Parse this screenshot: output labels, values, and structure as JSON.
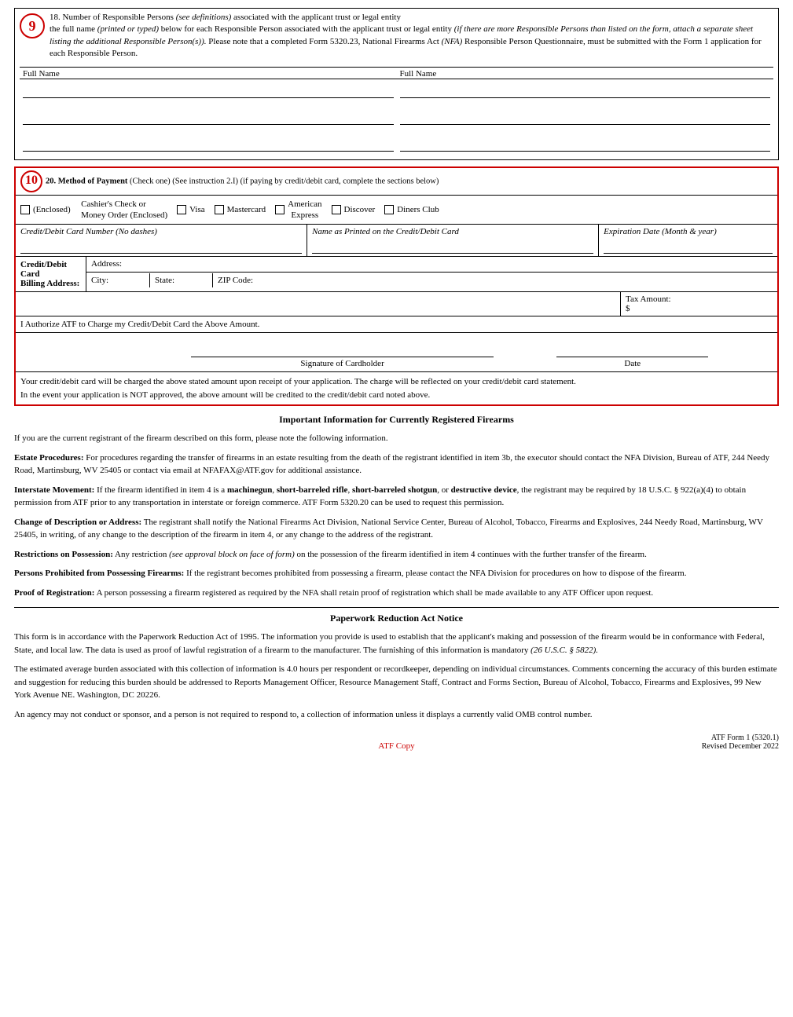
{
  "section18": {
    "number": "9",
    "header_prefix": "18. Number of Responsible Persons ",
    "header_italic": "(see definitions)",
    "header_suffix": " associated with the applicant trust or legal entity",
    "body": "the full name ",
    "body_italic1": "(printed or typed)",
    "body2": " below for each Responsible Person associated with the applicant trust or legal entity ",
    "body_italic2": "(if there are more Responsible Persons than listed on the form, attach a separate sheet listing the additional Responsible Person(s)).",
    "body3": " Please note that a completed Form 5320.23, National Firearms Act ",
    "body_italic3": "(NFA)",
    "body4": " Responsible Person Questionnaire, must be submitted with the Form 1 application for each Responsible Person.",
    "col1_label": "Full Name",
    "col2_label": "Full Name"
  },
  "section20": {
    "number": "10",
    "header": "20. Method of Payment ",
    "header_italic": "(Check one) (See instruction 2.I) (if paying by credit/debit card, complete the sections below)",
    "options": [
      {
        "label": "Money Order (Enclosed)",
        "sub": "Cashier's Check or\nMoney Order (Enclosed)"
      },
      {
        "label": "Visa"
      },
      {
        "label": "Mastercard"
      },
      {
        "label": "American\nExpress"
      },
      {
        "label": "Discover"
      },
      {
        "label": "Diners Club"
      }
    ],
    "enclosed_label": "(Enclosed)",
    "cashiers_line1": "Cashier's Check or",
    "cashiers_line2": "Money Order (Enclosed)",
    "visa_label": "Visa",
    "mastercard_label": "Mastercard",
    "american_express_label": "American\nExpress",
    "discover_label": "Discover",
    "diners_label": "Diners Club",
    "card_number_label": "Credit/Debit Card Number (No dashes)",
    "card_name_label": "Name as Printed on the Credit/Debit Card",
    "expiration_label": "Expiration Date (Month & year)",
    "address_label": "Address:",
    "billing_label": "Credit/Debit Card\nBilling Address:",
    "city_label": "City:",
    "state_label": "State:",
    "zip_label": "ZIP Code:",
    "tax_label": "Tax Amount:\n$",
    "authorize_text": "I Authorize ATF to Charge my Credit/Debit Card the Above Amount.",
    "signature_label": "Signature of Cardholder",
    "date_label": "Date",
    "card_notice_line1": "Your credit/debit card will be charged the above stated amount upon receipt of your application.  The charge will be reflected on your credit/debit card statement.",
    "card_notice_line2": "In the event your application is NOT approved, the above amount will be credited to the credit/debit card noted above."
  },
  "important_info": {
    "title": "Important Information for Currently Registered Firearms",
    "intro": "If you are the current registrant of the firearm described on this form, please note the following information.",
    "estate_title": "Estate Procedures:",
    "estate_text": " For procedures regarding the transfer of firearms in an estate resulting from the death of the registrant identified in item 3b, the executor should contact the NFA Division, Bureau of ATF, 244 Needy Road, Martinsburg, WV 25405 or contact via email at NFAFAX@ATF.gov for additional assistance.",
    "interstate_title": "Interstate Movement:",
    "interstate_text": "  If the firearm identified in item 4 is a ",
    "interstate_bold1": "machinegun",
    "interstate_comma1": ", ",
    "interstate_bold2": "short-barreled rifle",
    "interstate_comma2": ", ",
    "interstate_bold3": "short-barreled shotgun",
    "interstate_comma3": ", or ",
    "interstate_bold4": "destructive device",
    "interstate_text2": ", the registrant may be required by 18 U.S.C. § 922(a)(4) to obtain permission from ATF prior to any transportation in interstate or foreign commerce.  ATF Form 5320.20 can be used to request this permission.",
    "change_title": "Change of Description or Address:",
    "change_text": " The registrant shall notify the National Firearms Act Division, National Service Center, Bureau of Alcohol, Tobacco, Firearms and Explosives, 244 Needy Road, Martinsburg, WV 25405, in writing, of any change to the description of the firearm in item 4, or any change to the address of the registrant.",
    "restrictions_title": "Restrictions on Possession:",
    "restrictions_text": "  Any restriction ",
    "restrictions_italic": "(see approval block on face of form)",
    "restrictions_text2": " on the possession of the firearm identified in item 4 continues with the further transfer of the firearm.",
    "prohibited_title": "Persons Prohibited from Possessing Firearms:",
    "prohibited_text": "  If the registrant becomes prohibited from possessing a firearm, please contact the NFA Division for procedures on how to dispose of the firearm.",
    "proof_title": "Proof of Registration:",
    "proof_text": "  A person possessing a firearm registered as required by the NFA shall retain proof of registration which shall be made available to any ATF Officer upon request."
  },
  "paperwork": {
    "title": "Paperwork Reduction Act Notice",
    "para1": "This form is in accordance with the Paperwork Reduction Act of 1995.  The information you provide is used to establish that the applicant's making and possession of the firearm would be in conformance with Federal, State, and local law.  The data is used as proof of lawful registration of a firearm to the manufacturer.  The furnishing of this information is mandatory ",
    "para1_italic": "(26 U.S.C. § 5822).",
    "para2": "The estimated average burden associated with this collection of information is 4.0 hours per respondent or recordkeeper, depending on individual circumstances.  Comments concerning the accuracy of this burden estimate and suggestion for reducing this burden should be addressed to Reports Management Officer,  Resource Management Staff, Contract and Forms Section, Bureau of Alcohol, Tobacco, Firearms and Explosives, 99 New York Avenue NE. Washington, DC  20226.",
    "para3": "An agency may not conduct or sponsor, and a person is not required to respond to, a collection of information unless it displays a currently valid OMB control number."
  },
  "footer": {
    "atf_copy": "ATF Copy",
    "form_info": "ATF Form 1 (5320.1)\nRevised December 2022"
  }
}
